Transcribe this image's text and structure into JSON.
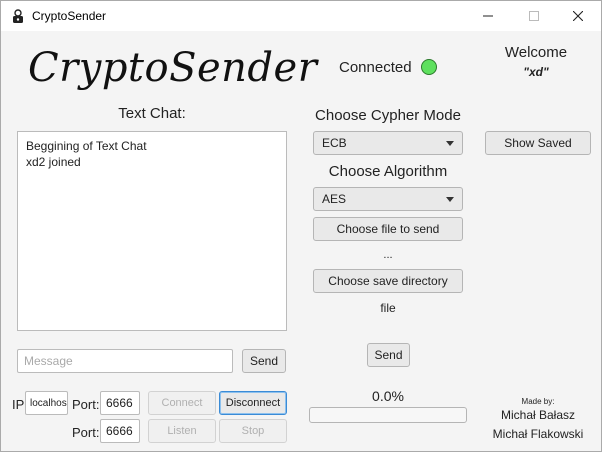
{
  "window": {
    "title": "CryptoSender",
    "icon": "lock-person-icon"
  },
  "header": {
    "logo": "CryptoSender",
    "status": "Connected",
    "status_color": "#5ee05e",
    "welcome": "Welcome",
    "username": "\"xd\""
  },
  "chat": {
    "label": "Text Chat:",
    "lines": [
      "Beggining of Text Chat",
      "xd2 joined"
    ],
    "message_placeholder": "Message",
    "send_label": "Send"
  },
  "connection": {
    "ip_label": "IP",
    "ip_value": "localhos",
    "port_label": "Port:",
    "port_value": "6666",
    "listen_port_label": "Port:",
    "listen_port_value": "6666",
    "connect_label": "Connect",
    "disconnect_label": "Disconnect",
    "listen_label": "Listen",
    "stop_label": "Stop"
  },
  "crypto": {
    "cypher_mode_label": "Choose Cypher Mode",
    "cypher_mode_value": "ECB",
    "algorithm_label": "Choose Algorithm",
    "algorithm_value": "AES",
    "choose_file_label": "Choose file to send",
    "file_name": "...",
    "choose_dir_label": "Choose save directory",
    "dir_name": "file",
    "send_file_label": "Send",
    "progress_text": "0.0%",
    "progress_fraction": 0.0
  },
  "side": {
    "show_saved_label": "Show Saved",
    "made_by_label": "Made by:",
    "authors": [
      "Michał Bałasz",
      "Michał Flakowski"
    ]
  },
  "colors": {
    "accent": "#3a8bd6"
  }
}
